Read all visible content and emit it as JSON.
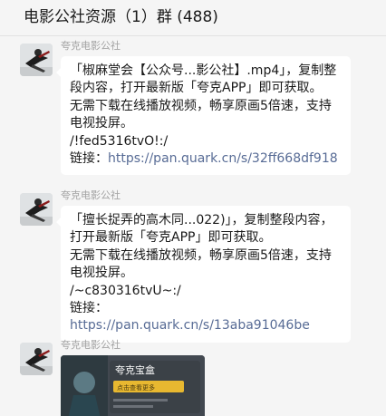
{
  "header": {
    "title": "电影公社资源（1）群 (488)"
  },
  "messages": [
    {
      "sender": "夸克电影公社",
      "lines": [
        "「椒麻堂会【公众号...影公社】.mp4」，复制整段内容，打开最新版「夸克APP」即可获取。",
        "无需下载在线播放视频，畅享原画5倍速，支持电视投屏。",
        "/!fed5316tvO!:/"
      ],
      "link_label": "链接：",
      "link_url": "https://pan.quark.cn/s/32ff668df918"
    },
    {
      "sender": "夸克电影公社",
      "lines": [
        "「擅长捉弄的高木同...022)」，复制整段内容，打开最新版「夸克APP」即可获取。",
        "无需下载在线播放视频，畅享原画5倍速，支持电视投屏。",
        "/~c830316tvU~:/"
      ],
      "link_label": "链接：",
      "link_url": "https://pan.quark.cn/s/13aba91046be"
    },
    {
      "sender": "夸克电影公社",
      "image_caption": "夸克宝盒",
      "image_tag": "点击查看更多"
    }
  ],
  "colors": {
    "background": "#f5f5f5",
    "bubble": "#ffffff",
    "link": "#576b95",
    "sender": "#a3a3a3"
  }
}
